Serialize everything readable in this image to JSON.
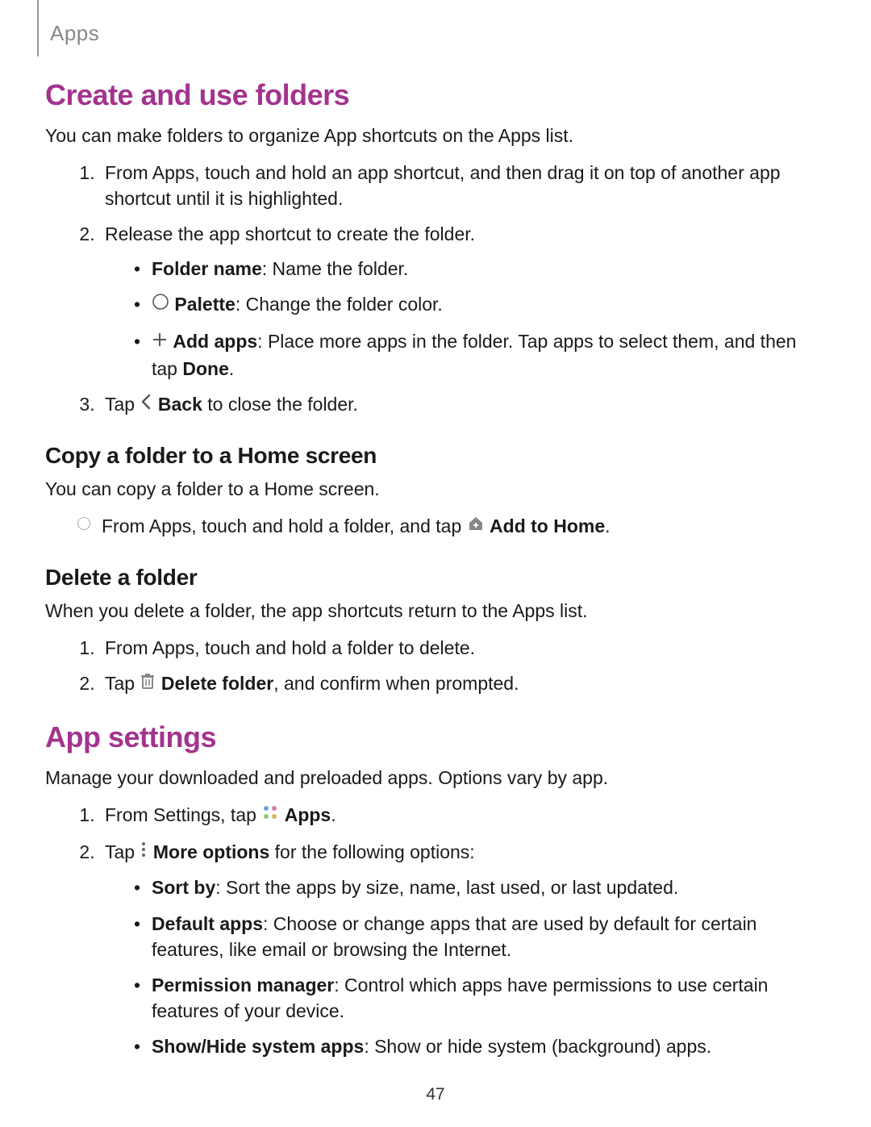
{
  "header": {
    "label": "Apps"
  },
  "section1": {
    "title": "Create and use folders",
    "intro": "You can make folders to organize App shortcuts on the Apps list.",
    "step1": "From Apps, touch and hold an app shortcut, and then drag it on top of another app shortcut until it is highlighted.",
    "step2": "Release the app shortcut to create the folder.",
    "sub_folder_name_b": "Folder name",
    "sub_folder_name_rest": ": Name the folder.",
    "sub_palette_b": "Palette",
    "sub_palette_rest": ": Change the folder color.",
    "sub_addapps_b": "Add apps",
    "sub_addapps_rest1": ": Place more apps in the folder. Tap apps to select them, and then tap ",
    "sub_addapps_done": "Done",
    "sub_addapps_rest2": ".",
    "step3_pre": "Tap ",
    "step3_back": "Back",
    "step3_post": " to close the folder."
  },
  "section_copy": {
    "title": "Copy a folder to a Home screen",
    "intro": "You can copy a folder to a Home screen.",
    "bullet_pre": "From Apps, touch and hold a folder, and tap ",
    "bullet_b": "Add to Home",
    "bullet_post": "."
  },
  "section_delete": {
    "title": "Delete a folder",
    "intro": "When you delete a folder, the app shortcuts return to the Apps list.",
    "step1": "From Apps, touch and hold a folder to delete.",
    "step2_pre": "Tap ",
    "step2_b": "Delete folder",
    "step2_post": ", and confirm when prompted."
  },
  "section2": {
    "title": "App settings",
    "intro": "Manage your downloaded and preloaded apps. Options vary by app.",
    "step1_pre": "From Settings, tap ",
    "step1_b": "Apps",
    "step1_post": ".",
    "step2_pre": "Tap ",
    "step2_b": "More options",
    "step2_post": " for the following options:",
    "opt_sort_b": "Sort by",
    "opt_sort_rest": ": Sort the apps by size, name, last used, or last updated.",
    "opt_default_b": "Default apps",
    "opt_default_rest": ": Choose or change apps that are used by default for certain features, like email or browsing the Internet.",
    "opt_perm_b": "Permission manager",
    "opt_perm_rest": ": Control which apps have permissions to use certain features of your device.",
    "opt_show_b": "Show/Hide system apps",
    "opt_show_rest": ": Show or hide system (background) apps."
  },
  "page_number": "47"
}
